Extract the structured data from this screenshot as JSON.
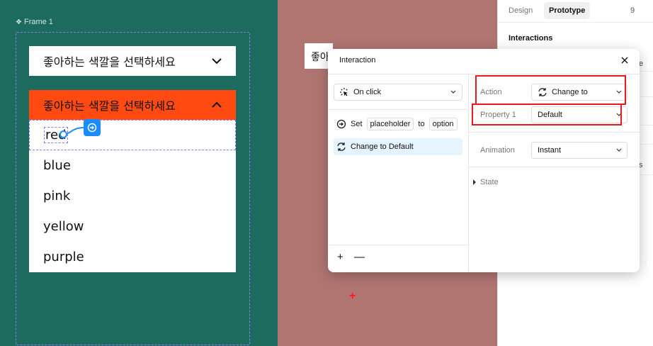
{
  "canvas": {
    "frame_label": "Frame 1",
    "colors": {
      "teal": "#1d6b5e",
      "rose": "#b07571",
      "accent": "#ff4a12",
      "selection": "#8a7cf0",
      "connector": "#1a8cff"
    },
    "dropdown_closed": {
      "text": "좋아하는 색깔을 선택하세요",
      "icon": "chevron-down-icon"
    },
    "dropdown_open": {
      "text": "좋아하는 색깔을 선택하세요",
      "icon": "chevron-up-icon"
    },
    "options": [
      "red",
      "blue",
      "pink",
      "yellow",
      "purple"
    ],
    "rose_box_text": "좋아",
    "crosshair": "+"
  },
  "right_panel": {
    "tabs": [
      "Design",
      "Prototype"
    ],
    "active_tab": "Prototype",
    "tab_extra": "9",
    "interactions_header": "Interactions",
    "peek_right_1": "e",
    "peek_right_2": "s"
  },
  "modal": {
    "title": "Interaction",
    "trigger": "On click",
    "actions": [
      {
        "set_label": "Set",
        "from": "placeholder",
        "to_label": "to",
        "value": "option"
      },
      {
        "label": "Change to Default",
        "selected": true
      }
    ],
    "add_label": "+",
    "remove_label": "—",
    "fields": {
      "action_label": "Action",
      "action_value": "Change to",
      "property_label": "Property 1",
      "property_value": "Default",
      "animation_label": "Animation",
      "animation_value": "Instant",
      "state_label": "State"
    }
  }
}
